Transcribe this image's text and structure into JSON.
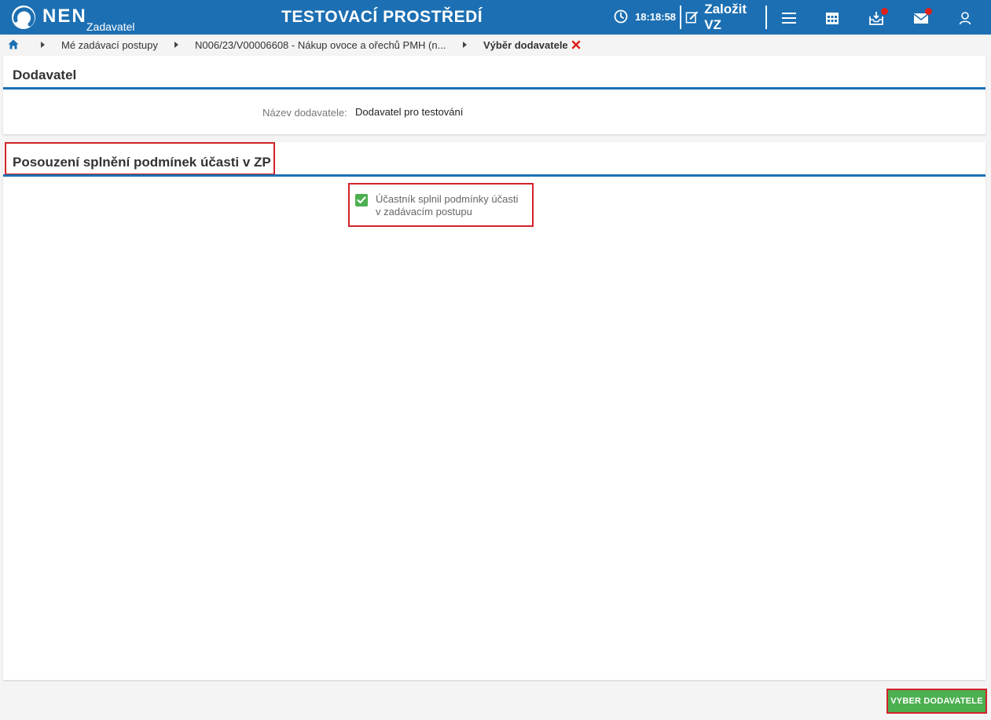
{
  "header": {
    "brand": "NEN",
    "brand_sub": "Zadavatel",
    "environment": "TESTOVACÍ PROSTŘEDÍ",
    "time": "18:18:58",
    "create_label": "Založit VZ",
    "icons": [
      "clock-icon",
      "edit-icon",
      "menu-icon",
      "calendar-icon",
      "inbox-icon",
      "mail-icon",
      "user-icon"
    ]
  },
  "breadcrumb": {
    "items": [
      "Mé zadávací postupy",
      "N006/23/V00006608 - Nákup ovoce a ořechů PMH (n...",
      "Výběr dodavatele"
    ]
  },
  "supplier_panel": {
    "title": "Dodavatel",
    "label": "Název dodavatele:",
    "value": "Dodavatel pro testování"
  },
  "conditions_panel": {
    "title": "Posouzení splnění podmínek účasti v ZP",
    "checkbox_line1": "Účastník splnil podmínky účasti",
    "checkbox_line2": "v zadávacím postupu",
    "checked": true
  },
  "actions": {
    "select_supplier": "VYBER DODAVATELE"
  },
  "colors": {
    "header": "#1c6fb2",
    "accent": "#1c6fb2",
    "success": "#4caf50",
    "highlight": "#d2232a",
    "notification": "#e0201b"
  }
}
